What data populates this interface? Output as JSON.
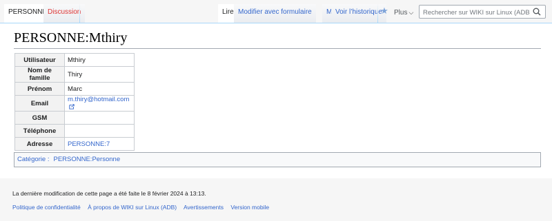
{
  "tabs": {
    "left": [
      {
        "label": "PERSONNE",
        "active": true
      },
      {
        "label": "Discussion",
        "active": false
      }
    ],
    "right": [
      {
        "label": "Lire",
        "active": true
      },
      {
        "label": "Modifier avec formulaire",
        "active": false
      },
      {
        "label": "Modifier",
        "active": false
      },
      {
        "label": "Voir l’historique",
        "active": false
      }
    ],
    "more_label": "Plus"
  },
  "search": {
    "placeholder": "Rechercher sur WIKI sur Linux (ADB)"
  },
  "page": {
    "title": "PERSONNE:Mthiry"
  },
  "infobox": {
    "rows": [
      {
        "label": "Utilisateur",
        "value": "Mthiry"
      },
      {
        "label": "Nom de famille",
        "value": "Thiry"
      },
      {
        "label": "Prénom",
        "value": "Marc"
      },
      {
        "label": "Email",
        "value": "m.thiry@hotmail.com"
      },
      {
        "label": "GSM",
        "value": ""
      },
      {
        "label": "Téléphone",
        "value": ""
      },
      {
        "label": "Adresse",
        "value": "PERSONNE:7"
      }
    ]
  },
  "categories": {
    "label": "Catégorie :",
    "items": [
      "PERSONNE:Personne"
    ]
  },
  "footer": {
    "last_modified": "La dernière modification de cette page a été faite le 8 février 2024 à 13:13.",
    "links": [
      "Politique de confidentialité",
      "À propos de WIKI sur Linux (ADB)",
      "Avertissements",
      "Version mobile"
    ]
  },
  "colors": {
    "link": "#3366cc",
    "redlink": "#dd3333",
    "border": "#a7d7f9",
    "background": "#f6f6f6"
  }
}
